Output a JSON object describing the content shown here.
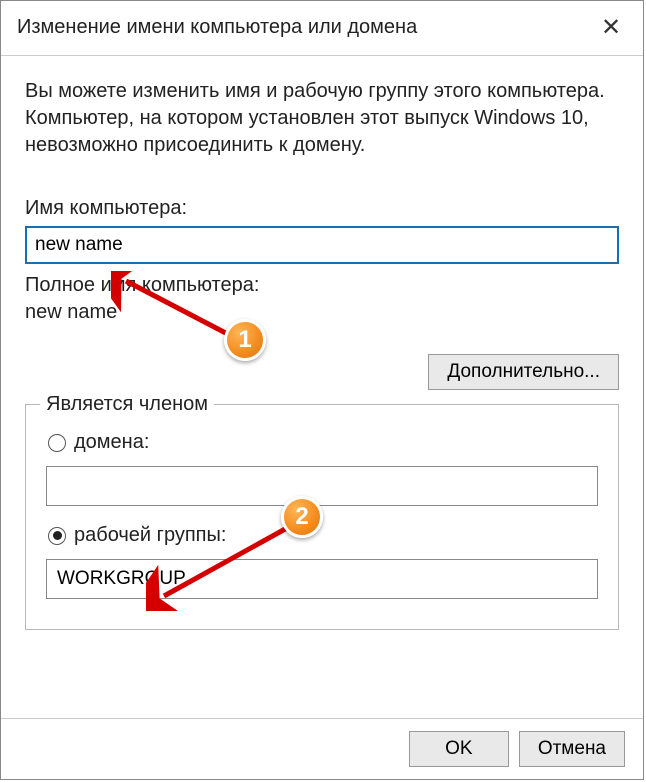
{
  "window": {
    "title": "Изменение имени компьютера или домена"
  },
  "description": "Вы можете изменить имя и рабочую группу этого компьютера. Компьютер, на котором установлен этот выпуск Windows 10, невозможно присоединить к домену.",
  "computer_name": {
    "label": "Имя компьютера:",
    "value": "new name"
  },
  "full_name": {
    "label": "Полное имя компьютера:",
    "value": "new name"
  },
  "buttons": {
    "more": "Дополнительно...",
    "ok": "OK",
    "cancel": "Отмена"
  },
  "membership": {
    "title": "Является членом",
    "domain_label": "домена:",
    "domain_value": "",
    "workgroup_label": "рабочей группы:",
    "workgroup_value": "WORKGROUP",
    "selected": "workgroup"
  },
  "annotations": {
    "badge1": "1",
    "badge2": "2"
  }
}
